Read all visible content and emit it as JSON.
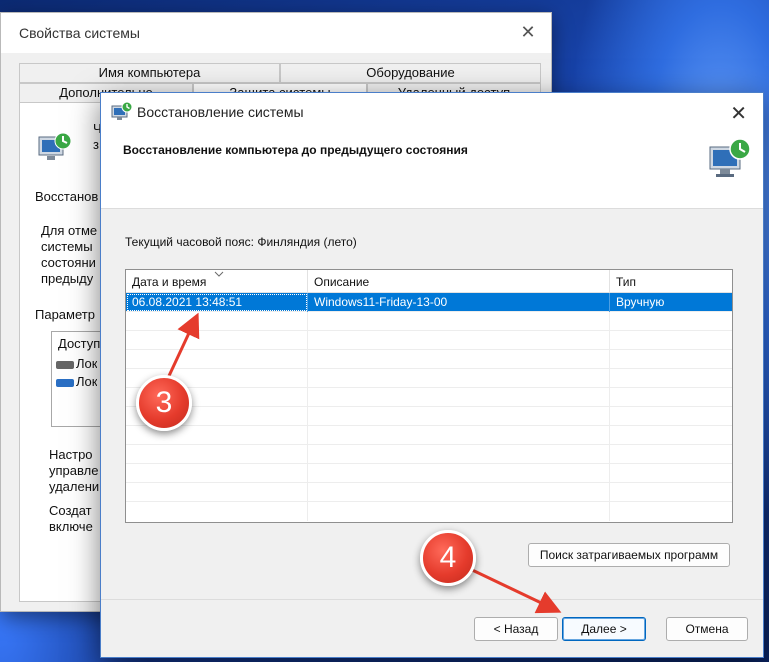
{
  "sys_props": {
    "title": "Свойства системы",
    "tabs_row1": [
      "Имя компьютера",
      "Оборудование"
    ],
    "tabs_row2": [
      "Дополнительно",
      "Защита системы",
      "Удаленный доступ"
    ],
    "clipped": {
      "desc_1": "Ч",
      "desc_2": "з",
      "restore_heading": "Восстанов",
      "restore_desc_1": "Для отме",
      "restore_desc_2": "системы",
      "restore_desc_3": "состояни",
      "restore_desc_4": "предыду",
      "params_heading": "Параметр",
      "avail_header": "Доступ",
      "drive_1": "Лок",
      "drive_2": "Лок",
      "config_1": "Настро",
      "config_2": "управле",
      "config_3": "удалени",
      "create_1": "Создат",
      "create_2": "включе"
    }
  },
  "restore": {
    "title": "Восстановление системы",
    "header": "Восстановление компьютера до предыдущего состояния",
    "timezone": "Текущий часовой пояс: Финляндия (лето)",
    "columns": [
      "Дата и время",
      "Описание",
      "Тип"
    ],
    "rows": [
      {
        "date": "06.08.2021 13:48:51",
        "description": "Windows11-Friday-13-00",
        "type": "Вручную",
        "selected": true
      }
    ],
    "scan_button": "Поиск затрагиваемых программ",
    "back_button": "< Назад",
    "next_button": "Далее >",
    "cancel_button": "Отмена"
  },
  "annotations": {
    "step_3": "3",
    "step_4": "4"
  },
  "colors": {
    "selection": "#0078d7",
    "marker": "#e53b2c",
    "accent_border": "#0067c0"
  }
}
